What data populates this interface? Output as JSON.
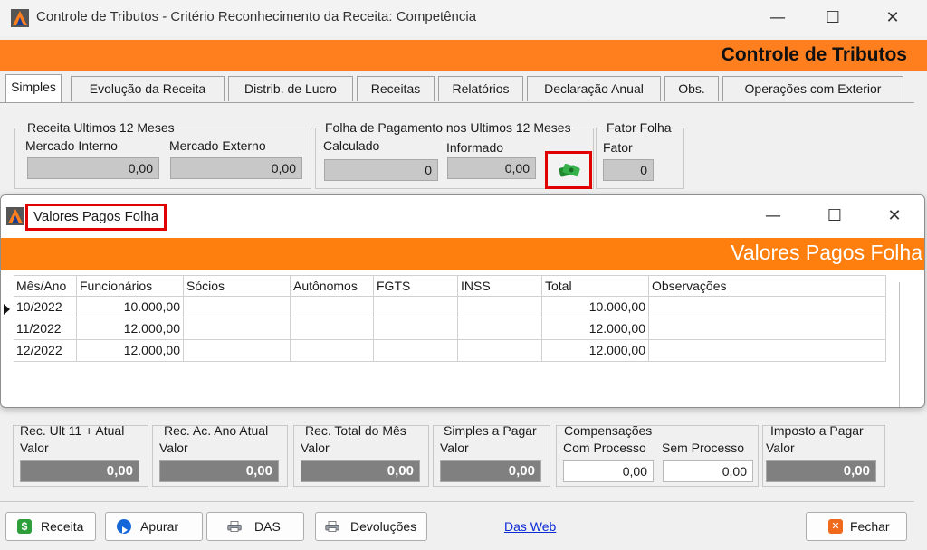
{
  "window": {
    "title": "Controle de Tributos - Critério Reconhecimento da Receita:  Competência",
    "minimize": "—",
    "maximize": "☐",
    "close": "✕",
    "banner": "Controle de Tributos"
  },
  "tabs": [
    {
      "label": "Simples",
      "active": true
    },
    {
      "label": "Evolução da Receita"
    },
    {
      "label": "Distrib. de Lucro"
    },
    {
      "label": "Receitas"
    },
    {
      "label": "Relatórios"
    },
    {
      "label": "Declaração Anual"
    },
    {
      "label": "Obs."
    },
    {
      "label": "Operações com Exterior"
    }
  ],
  "receita12": {
    "title": "Receita Ultimos 12 Meses",
    "interno_label": "Mercado Interno",
    "interno_value": "0,00",
    "externo_label": "Mercado Externo",
    "externo_value": "0,00"
  },
  "folha12": {
    "title": "Folha de Pagamento nos Ultimos 12 Meses",
    "calculado_label": "Calculado",
    "calculado_value": "0",
    "informado_label": "Informado",
    "informado_value": "0,00"
  },
  "fator": {
    "title": "Fator Folha",
    "label": "Fator",
    "value": "0"
  },
  "popup": {
    "title": "Valores Pagos Folha",
    "minimize": "—",
    "maximize": "☐",
    "close": "✕",
    "banner": "Valores Pagos Folha",
    "columns": [
      "Mês/Ano",
      "Funcionários",
      "Sócios",
      "Autônomos",
      "FGTS",
      "INSS",
      "Total",
      "Observações"
    ],
    "rows": [
      {
        "mes": "10/2022",
        "funcionarios": "10.000,00",
        "total": "10.000,00"
      },
      {
        "mes": "11/2022",
        "funcionarios": "12.000,00",
        "total": "12.000,00"
      },
      {
        "mes": "12/2022",
        "funcionarios": "12.000,00",
        "total": "12.000,00"
      }
    ]
  },
  "summary": {
    "rec_ult": {
      "title": "Rec. Ult  11 + Atual",
      "label": "Valor",
      "value": "0,00"
    },
    "rec_ac": {
      "title": "Rec. Ac. Ano Atual",
      "label": "Valor",
      "value": "0,00"
    },
    "rec_total": {
      "title": "Rec. Total do Mês",
      "label": "Valor",
      "value": "0,00"
    },
    "simples": {
      "title": "Simples a Pagar",
      "label": "Valor",
      "value": "0,00"
    },
    "compensacoes": {
      "title": "Compensações",
      "com_label": "Com Processo",
      "com_value": "0,00",
      "sem_label": "Sem Processo",
      "sem_value": "0,00"
    },
    "imposto": {
      "title": "Imposto a Pagar",
      "label": "Valor",
      "value": "0,00"
    }
  },
  "buttons": {
    "receita": "Receita",
    "apurar": "Apurar",
    "das": "DAS",
    "devolucoes": "Devoluções",
    "das_web": "Das Web",
    "fechar": "Fechar"
  },
  "colors": {
    "banner": "#ff7f1f",
    "highlight": "#e00000",
    "link": "#0a2bd6"
  }
}
